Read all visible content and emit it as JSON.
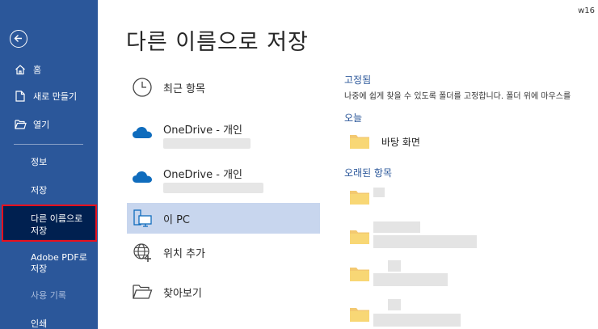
{
  "window": {
    "corner_text": "w16"
  },
  "sidebar": {
    "back_icon": "back-arrow-icon",
    "home": "홈",
    "new": "새로 만들기",
    "open": "열기",
    "info": "정보",
    "save": "저장",
    "save_as_line1": "다른 이름으로",
    "save_as_line2": "저장",
    "adobe_line1": "Adobe PDF로",
    "adobe_line2": "저장",
    "history": "사용 기록",
    "print": "인쇄"
  },
  "main": {
    "title": "다른 이름으로 저장",
    "locations": {
      "recent": "최근 항목",
      "onedrive1": "OneDrive - 개인",
      "onedrive2": "OneDrive - 개인",
      "this_pc": "이 PC",
      "add_place": "위치 추가",
      "browse": "찾아보기"
    },
    "pinned_header": "고정됨",
    "pinned_hint": "나중에 쉽게 찾을 수 있도록 폴더를 고정합니다. 폴더 위에 마우스를",
    "today_header": "오늘",
    "today_folder": "바탕 화면",
    "older_header": "오래된 항목"
  },
  "colors": {
    "sidebar_bg": "#2b579a",
    "selected_bg": "#002050",
    "highlight_border": "#e8101d",
    "active_location": "#c8d6ee",
    "folder": "#f3c971"
  }
}
